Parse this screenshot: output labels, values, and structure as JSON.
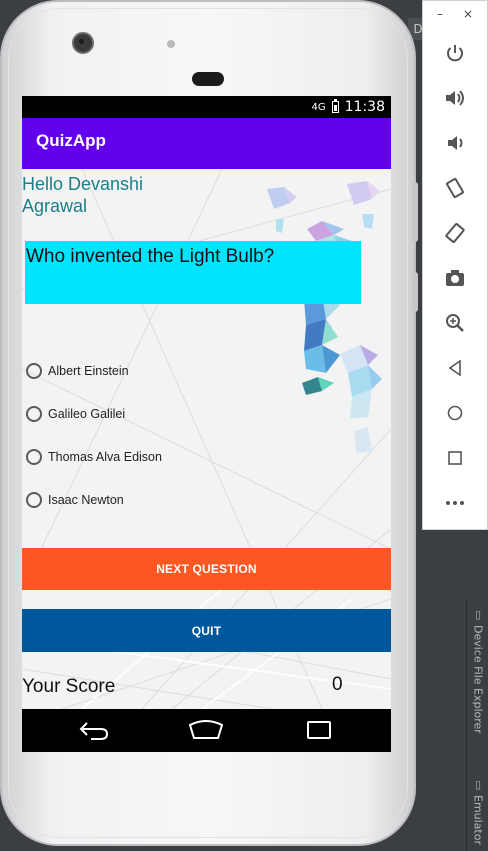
{
  "ide": {
    "top_tab_letter": "D",
    "side_tabs": [
      "Device File Explorer",
      "Emulator"
    ]
  },
  "status_bar": {
    "network": "4G",
    "time": "11:38"
  },
  "app": {
    "title": "QuizApp",
    "greeting": "Hello Devanshi Agrawal",
    "question": "Who invented the Light Bulb?",
    "options": [
      {
        "label": "Albert Einstein",
        "selected": false
      },
      {
        "label": "Galileo Galilei",
        "selected": false
      },
      {
        "label": "Thomas Alva Edison",
        "selected": false
      },
      {
        "label": "Isaac Newton",
        "selected": false
      }
    ],
    "next_button": "NEXT QUESTION",
    "quit_button": "QUIT",
    "score_label": "Your Score",
    "score_value": "0"
  },
  "colors": {
    "app_bar": "#6200ee",
    "question_bg": "#00e4ff",
    "next_button": "#ff5722",
    "quit_button": "#01579b",
    "greeting_text": "#1b7f8a"
  },
  "emulator_panel": {
    "minimize": "–",
    "close": "×",
    "icons": [
      "power-icon",
      "volume-up-icon",
      "volume-down-icon",
      "rotate-left-icon",
      "rotate-right-icon",
      "camera-icon",
      "zoom-icon",
      "back-icon",
      "home-icon",
      "overview-icon",
      "more-icon"
    ]
  }
}
